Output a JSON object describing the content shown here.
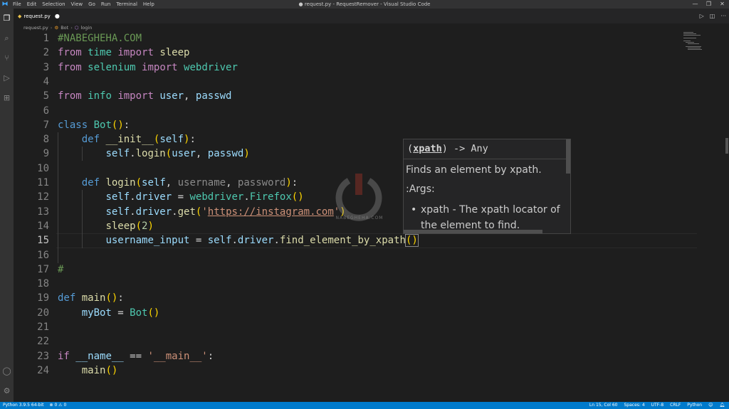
{
  "window": {
    "title": "● request.py - RequestRemover - Visual Studio Code",
    "menu": [
      "File",
      "Edit",
      "Selection",
      "View",
      "Go",
      "Run",
      "Terminal",
      "Help"
    ]
  },
  "tab": {
    "label": "request.py",
    "modified_dot": "●"
  },
  "breadcrumb": {
    "file": "request.py",
    "class": "Bot",
    "method": "login"
  },
  "editor": {
    "line_numbers": [
      "1",
      "2",
      "3",
      "4",
      "5",
      "6",
      "7",
      "8",
      "9",
      "10",
      "11",
      "12",
      "13",
      "14",
      "15",
      "16",
      "17",
      "18",
      "19",
      "20",
      "21",
      "22",
      "23",
      "24"
    ],
    "active_line": "15"
  },
  "hover": {
    "signature_param": "xpath",
    "signature_rest": ") -> Any",
    "description": "Finds an element by xpath.",
    "args_label": ":Args:",
    "bullet": "xpath - The xpath locator of the element to find."
  },
  "watermark": {
    "text": "NABEGHEHA.COM"
  },
  "status": {
    "python": "Python 3.9.5 64-bit",
    "problems": "⊗ 0 ⚠ 0",
    "position": "Ln 15, Col 60",
    "spaces": "Spaces: 4",
    "encoding": "UTF-8",
    "eol": "CRLF",
    "language": "Python"
  },
  "colors": {
    "accent": "#007acc",
    "editor_bg": "#1e1e1e"
  }
}
